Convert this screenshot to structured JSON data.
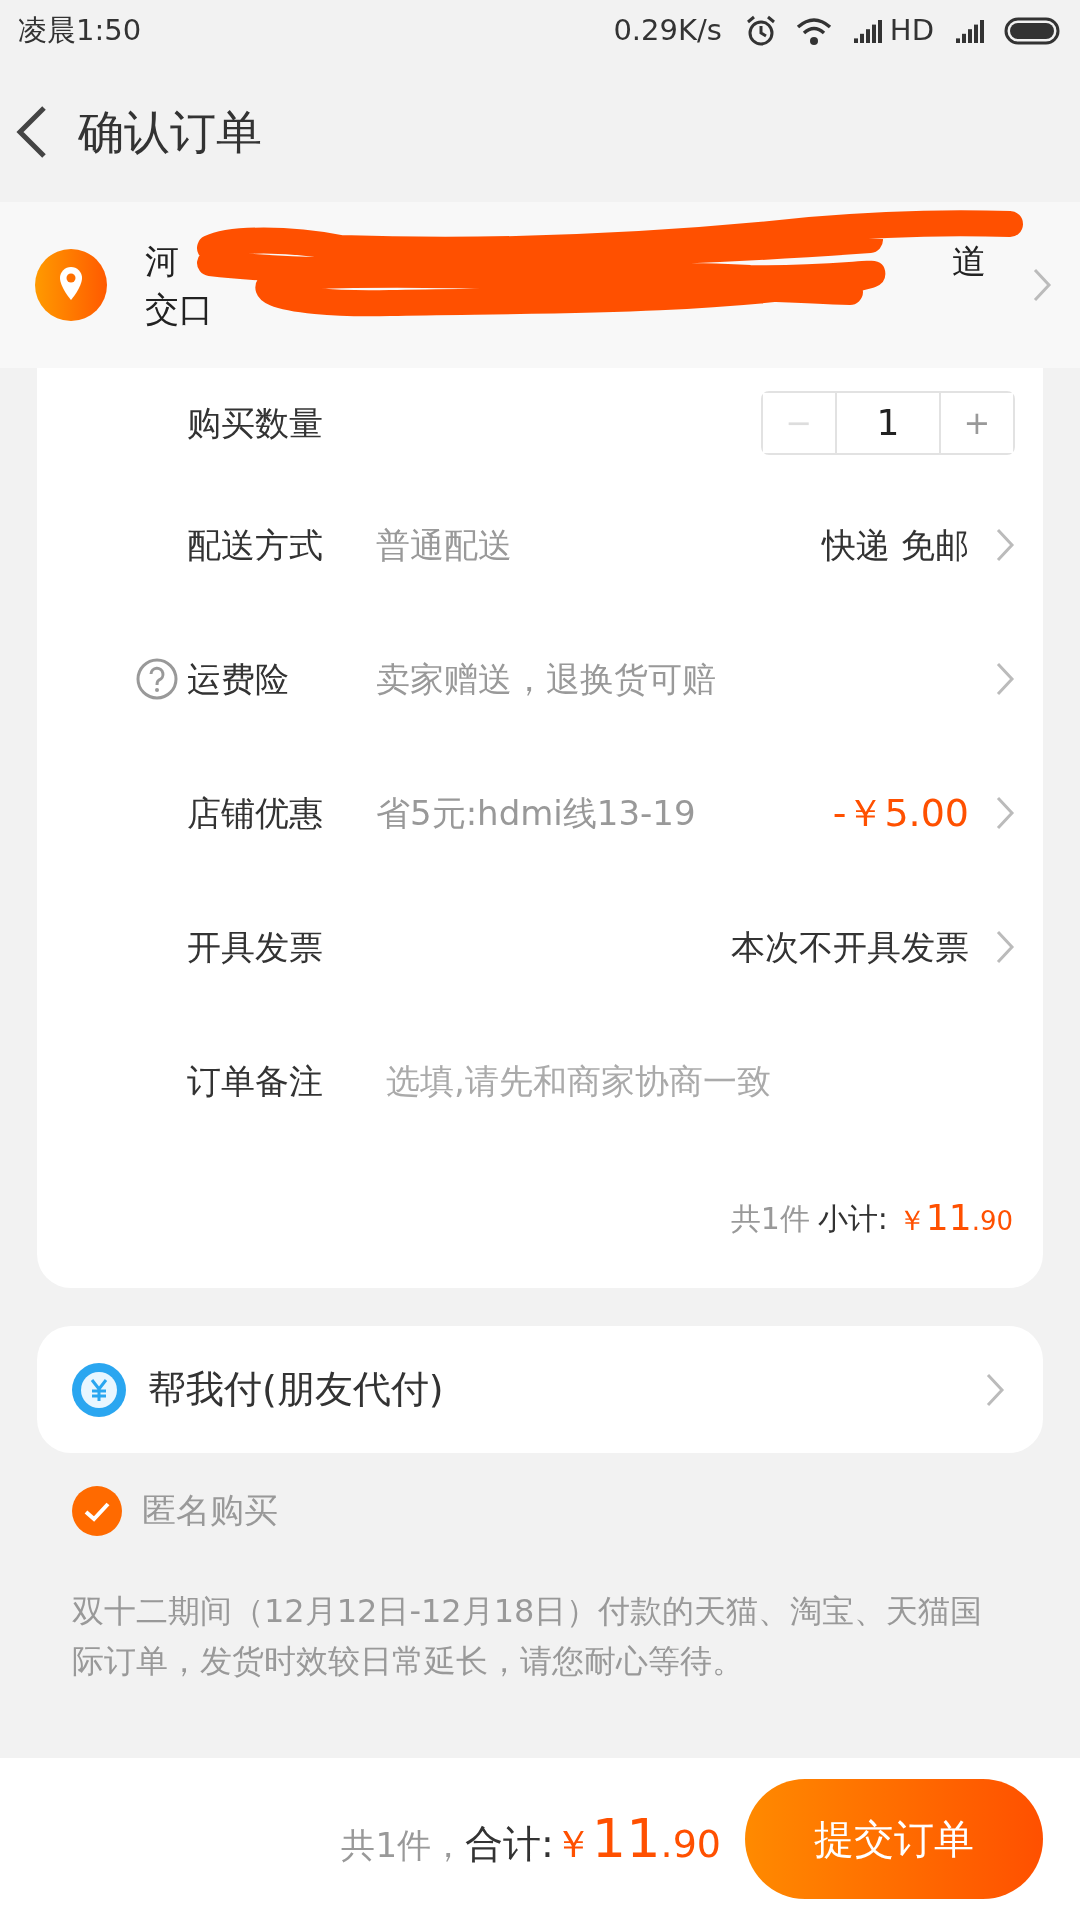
{
  "status_bar": {
    "time": "凌晨1:50",
    "speed": "0.29K/s",
    "network": "HD"
  },
  "header": {
    "title": "确认订单"
  },
  "address": {
    "line_1_start": "河",
    "line_1_end": "道",
    "line_2_start": "交口"
  },
  "rows": [
    {
      "kind": "stepper",
      "label": "购买数量",
      "minus": "−",
      "value": "1",
      "plus": "+",
      "minus_disabled": true
    },
    {
      "kind": "option",
      "label": "配送方式",
      "detail": "普通配送",
      "value": "快递 免邮"
    },
    {
      "kind": "option",
      "label": "运费险",
      "help": true,
      "detail": "卖家赠送，退换货可赔"
    },
    {
      "kind": "option",
      "label": "店铺优惠",
      "detail": "省5元:hdmi线13-19",
      "value": "-￥5.00",
      "highlight": true
    },
    {
      "kind": "option",
      "label": "开具发票",
      "value": "本次不开具发票"
    },
    {
      "kind": "input",
      "label": "订单备注",
      "placeholder": "选填,请先和商家协商一致"
    }
  ],
  "subtotal": {
    "count": "共1件",
    "label": "小计:",
    "price": {
      "symbol": "￥",
      "integer": "11",
      "decimal": ".90"
    }
  },
  "friend_pay": {
    "label": "帮我付(朋友代付)"
  },
  "anonymous": {
    "label": "匿名购买",
    "checked": true
  },
  "notice": "双十二期间（12月12日-12月18日）付款的天猫、淘宝、天猫国际订单，发货时效较日常延长，请您耐心等待。",
  "footer": {
    "count": "共1件，",
    "label": "合计:",
    "price": {
      "symbol": "￥",
      "integer": "11",
      "decimal": ".90"
    },
    "button": "提交订单"
  }
}
